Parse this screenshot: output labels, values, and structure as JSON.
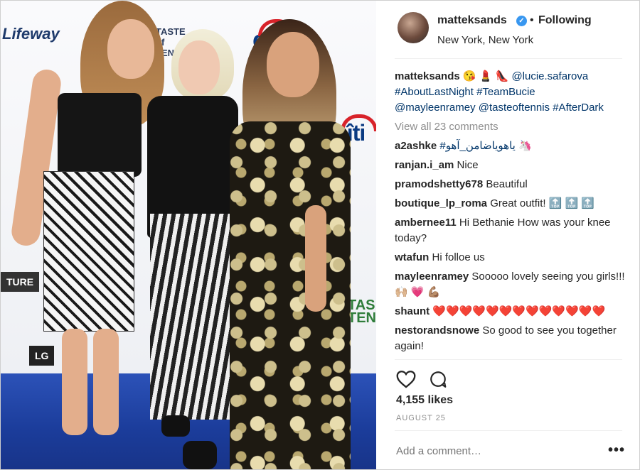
{
  "photo": {
    "logos": [
      "Lifeway",
      "cîti",
      "TASTE of TENNIS",
      "LG",
      "TURE",
      "TAS TEN"
    ]
  },
  "header": {
    "username": "matteksands",
    "following_label": "Following",
    "location": "New York, New York"
  },
  "caption": {
    "username": "matteksands",
    "emojis": "😘 💄 👠",
    "text_line1": "@lucie.safarova",
    "hashtags": "#AboutLastNight #TeamBucie",
    "mentions": "@mayleenramey @tasteoftennis #AfterDark"
  },
  "view_all_label": "View all 23 comments",
  "comments": [
    {
      "user": "a2ashke",
      "text": "#یاهویاضامن_آهو 🦄"
    },
    {
      "user": "ranjan.i_am",
      "text": "Nice"
    },
    {
      "user": "pramodshetty678",
      "text": "Beautiful"
    },
    {
      "user": "boutique_lp_roma",
      "text": "Great outfit! 🔝 🔝 🔝"
    },
    {
      "user": "ambernee11",
      "text": "Hi Bethanie How was your knee today?"
    },
    {
      "user": "wtafun",
      "text": "Hi folloe us"
    },
    {
      "user": "mayleenramey",
      "text": "Sooooo lovely seeing you girls!!! 🙌🏼 💗 💪🏽"
    },
    {
      "user": "shaunt",
      "text": "❤️❤️❤️❤️❤️❤️❤️❤️❤️❤️❤️❤️❤️"
    },
    {
      "user": "nestorandsnowe",
      "text": "So good to see you together again!"
    }
  ],
  "actions": {
    "likes": "4,155 likes",
    "date": "AUGUST 25",
    "add_comment_placeholder": "Add a comment…",
    "more_label": "•••"
  },
  "colors": {
    "link": "#003569",
    "muted": "#8e8e8e",
    "verified": "#3897f0",
    "carpet": "#1b3c9a"
  }
}
